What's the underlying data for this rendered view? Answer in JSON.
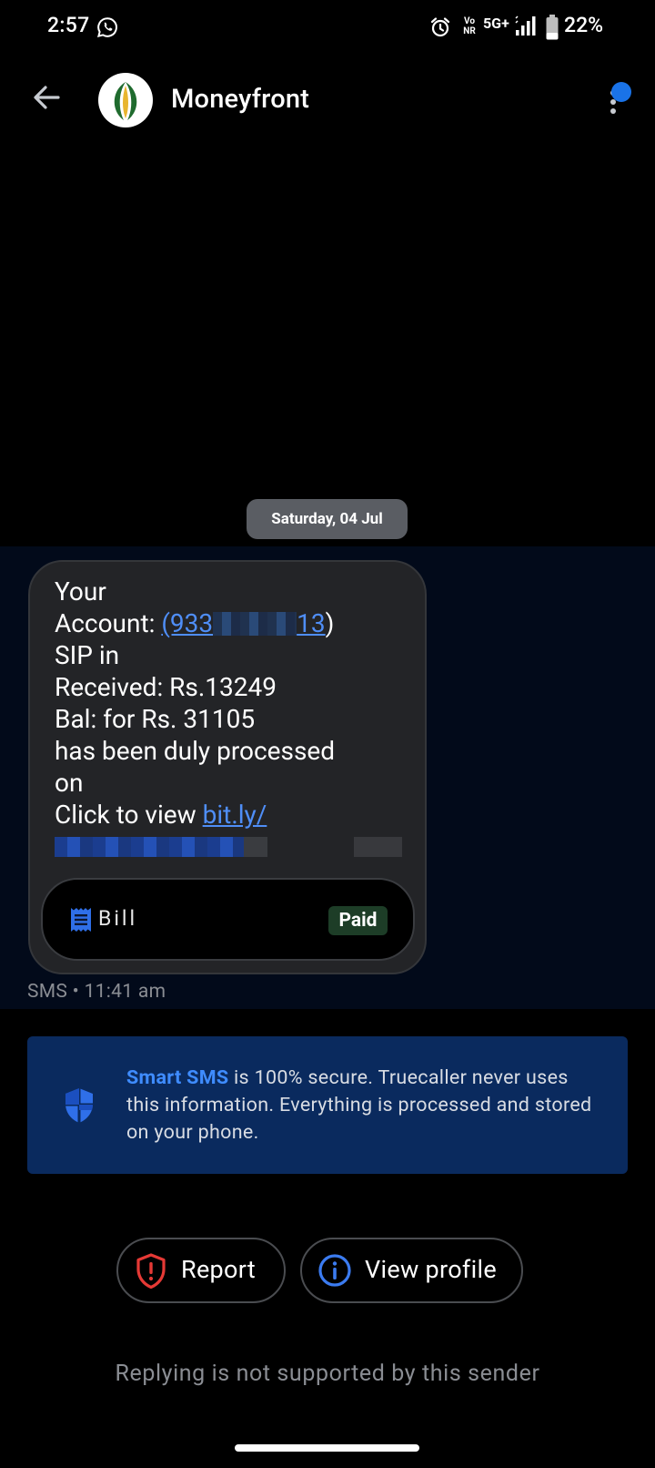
{
  "status_bar": {
    "time": "2:57",
    "network_top": "Vo",
    "network_bottom": "NR",
    "network": "5G+",
    "battery": "22%",
    "icons": [
      "whatsapp-icon",
      "alarm-icon",
      "signal-icon",
      "battery-icon"
    ]
  },
  "header": {
    "contact_name": "Moneyfront",
    "icons": [
      "back-arrow-icon",
      "more-vertical-icon"
    ],
    "unread_indicator_color": "#1a73e8"
  },
  "conversation": {
    "date_chip": "Saturday, 04 Jul",
    "message": {
      "line1": "Your",
      "account_prefix": "Account: ",
      "account_link_start": "(933",
      "account_link_end": "13",
      "account_suffix": ")",
      "line3": "SIP in",
      "line4": "Received: Rs.13249",
      "line5": "Bal:  for Rs. 31105",
      "line6": "has been duly processed",
      "line7": "on",
      "click_prefix": "Click to view ",
      "short_link": "bit.ly/"
    },
    "bill_card": {
      "label": "Bill",
      "status": "Paid",
      "icon": "receipt-icon"
    },
    "meta": "SMS • 11:41 am"
  },
  "smart_sms": {
    "strong": "Smart SMS",
    "text": " is 100% secure. Truecaller never uses this information. Everything is processed and stored on your phone.",
    "icon": "shield-icon"
  },
  "actions": {
    "report_label": "Report",
    "profile_label": "View profile",
    "report_icon": "report-shield-icon",
    "profile_icon": "info-icon"
  },
  "footer_note": "Replying is not supported by this sender",
  "colors": {
    "accent_link": "#4f8ef7",
    "info_box": "#0a2a5e",
    "report_red": "#e53935",
    "paid_green": "#1d3d27"
  }
}
